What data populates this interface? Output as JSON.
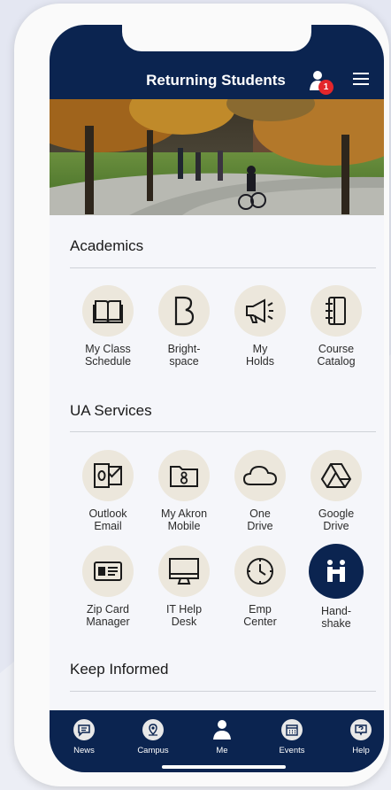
{
  "header": {
    "title": "Returning Students",
    "notification_count": "1"
  },
  "colors": {
    "navy": "#0b2450",
    "tile_bg": "#ece7dc",
    "badge": "#e3262b"
  },
  "sections": [
    {
      "title": "Academics",
      "tiles": [
        {
          "label": "My Class\nSchedule",
          "icon": "book-icon"
        },
        {
          "label": "Bright-\nspace",
          "icon": "brightspace-icon"
        },
        {
          "label": "My\nHolds",
          "icon": "megaphone-icon"
        },
        {
          "label": "Course\nCatalog",
          "icon": "notebook-icon"
        }
      ]
    },
    {
      "title": "UA Services",
      "tiles": [
        {
          "label": "Outlook\nEmail",
          "icon": "outlook-icon"
        },
        {
          "label": "My Akron\nMobile",
          "icon": "folder-icon"
        },
        {
          "label": "One\nDrive",
          "icon": "cloud-icon"
        },
        {
          "label": "Google\nDrive",
          "icon": "google-drive-icon"
        },
        {
          "label": "Zip Card\nManager",
          "icon": "id-card-icon"
        },
        {
          "label": "IT Help\nDesk",
          "icon": "monitor-icon"
        },
        {
          "label": "Emp\nCenter",
          "icon": "clock-icon"
        },
        {
          "label": "Hand-\nshake",
          "icon": "handshake-icon"
        }
      ]
    },
    {
      "title": "Keep Informed",
      "tiles": []
    }
  ],
  "tabbar": [
    {
      "label": "News",
      "icon": "chat-icon"
    },
    {
      "label": "Campus",
      "icon": "campus-pin-icon"
    },
    {
      "label": "Me",
      "icon": "person-icon"
    },
    {
      "label": "Events",
      "icon": "calendar-icon"
    },
    {
      "label": "Help",
      "icon": "help-chat-icon"
    }
  ]
}
